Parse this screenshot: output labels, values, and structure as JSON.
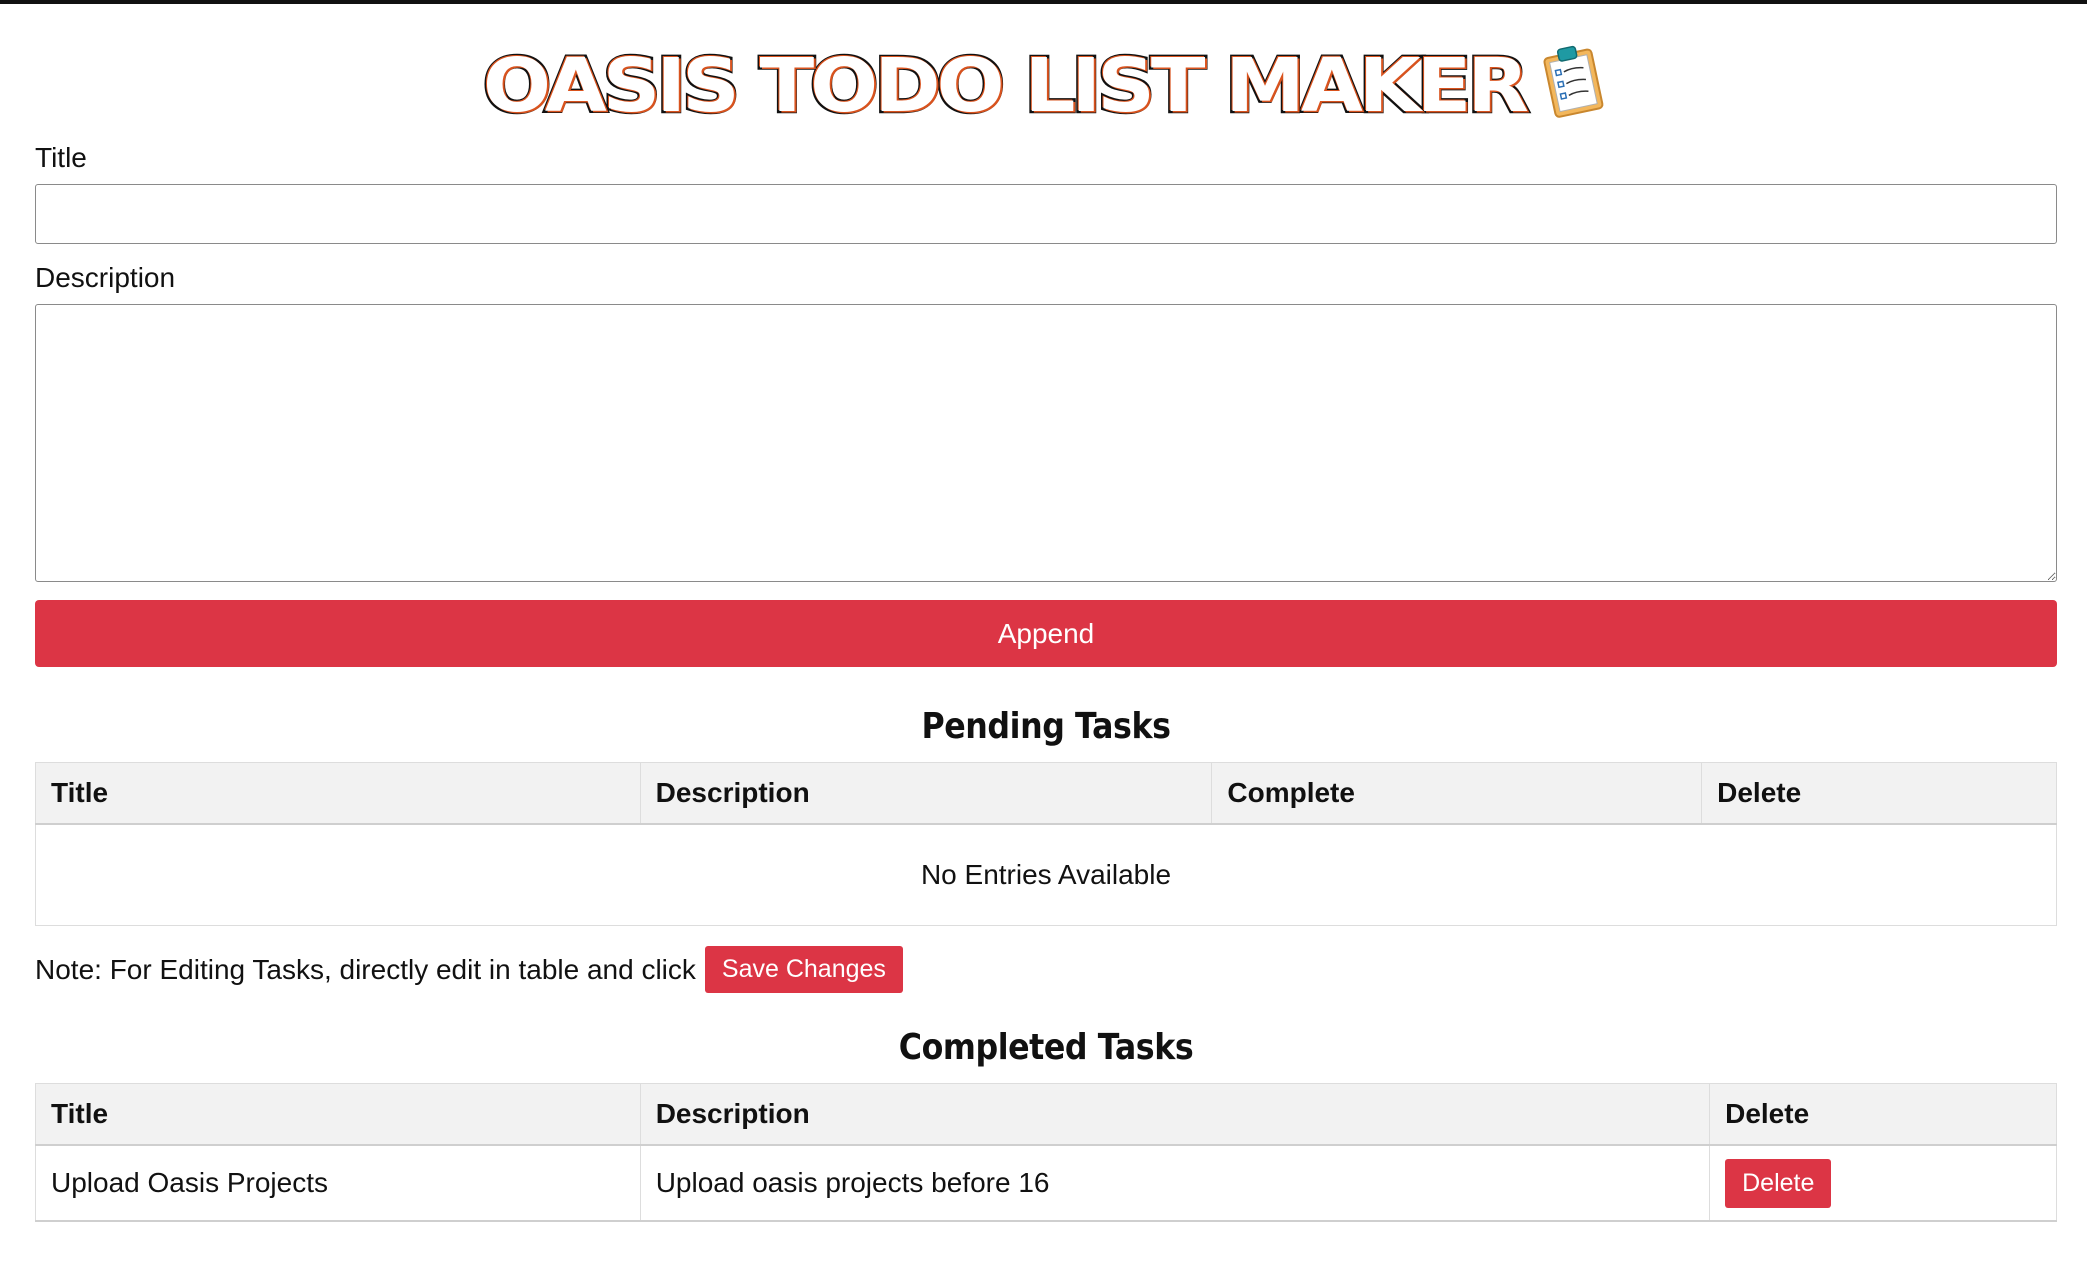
{
  "header": {
    "app_title": "OASIS TODO LIST MAKER",
    "icon": "clipboard-checklist-icon"
  },
  "form": {
    "title_label": "Title",
    "title_value": "",
    "description_label": "Description",
    "description_value": "",
    "append_label": "Append"
  },
  "pending": {
    "heading": "Pending Tasks",
    "columns": [
      "Title",
      "Description",
      "Complete",
      "Delete"
    ],
    "empty_message": "No Entries Available"
  },
  "note": {
    "text": "Note: For Editing Tasks, directly edit in table and click",
    "save_label": "Save Changes"
  },
  "completed": {
    "heading": "Completed Tasks",
    "columns": [
      "Title",
      "Description",
      "Delete"
    ],
    "rows": [
      {
        "title": "Upload Oasis Projects",
        "description": "Upload oasis projects before 16",
        "delete_label": "Delete"
      }
    ]
  },
  "colors": {
    "accent": "#dc3545",
    "header_bg": "#f2f2f2",
    "text": "#111111"
  }
}
